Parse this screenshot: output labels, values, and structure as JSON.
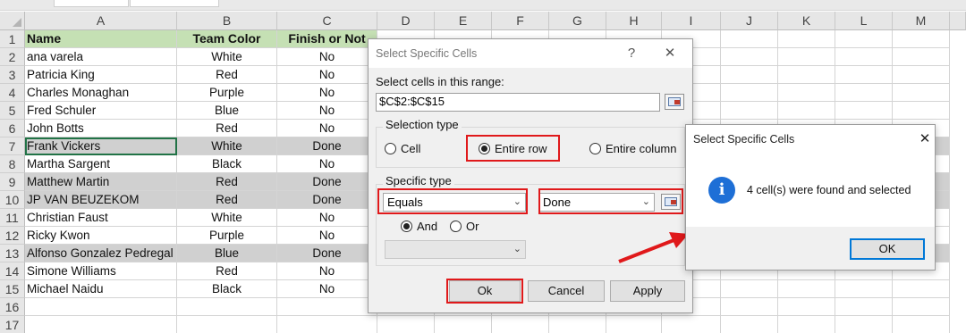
{
  "spreadsheet": {
    "columns": [
      "A",
      "B",
      "C",
      "D",
      "E",
      "F",
      "G",
      "H",
      "I",
      "J",
      "K",
      "L",
      "M"
    ],
    "rows": [
      {
        "num": "1",
        "a": "Name",
        "b": "Team Color",
        "c": "Finish or Not",
        "header": true
      },
      {
        "num": "2",
        "a": "ana varela",
        "b": "White",
        "c": "No"
      },
      {
        "num": "3",
        "a": "Patricia King",
        "b": "Red",
        "c": "No"
      },
      {
        "num": "4",
        "a": "Charles Monaghan",
        "b": "Purple",
        "c": "No"
      },
      {
        "num": "5",
        "a": "Fred Schuler",
        "b": "Blue",
        "c": "No"
      },
      {
        "num": "6",
        "a": "John Botts",
        "b": "Red",
        "c": "No"
      },
      {
        "num": "7",
        "a": "Frank Vickers",
        "b": "White",
        "c": "Done",
        "selected": true
      },
      {
        "num": "8",
        "a": "Martha Sargent",
        "b": "Black",
        "c": "No"
      },
      {
        "num": "9",
        "a": "Matthew Martin",
        "b": "Red",
        "c": "Done",
        "selected": true
      },
      {
        "num": "10",
        "a": "JP VAN BEUZEKOM",
        "b": "Red",
        "c": "Done",
        "selected": true
      },
      {
        "num": "11",
        "a": "Christian Faust",
        "b": "White",
        "c": "No"
      },
      {
        "num": "12",
        "a": "Ricky Kwon",
        "b": "Purple",
        "c": "No"
      },
      {
        "num": "13",
        "a": "Alfonso Gonzalez Pedregal",
        "b": "Blue",
        "c": "Done",
        "selected": true
      },
      {
        "num": "14",
        "a": "Simone Williams",
        "b": "Red",
        "c": "No"
      },
      {
        "num": "15",
        "a": "Michael Naidu",
        "b": "Black",
        "c": "No"
      },
      {
        "num": "16",
        "a": "",
        "b": "",
        "c": ""
      },
      {
        "num": "17",
        "a": "",
        "b": "",
        "c": ""
      }
    ]
  },
  "select_dialog": {
    "title": "Select Specific Cells",
    "help": "?",
    "close": "✕",
    "range_label": "Select cells in this range:",
    "range_value": "$C$2:$C$15",
    "selection_type_label": "Selection type",
    "opt_cell": "Cell",
    "opt_entire_row": "Entire row",
    "opt_entire_column": "Entire column",
    "specific_type_label": "Specific type",
    "condition1": "Equals",
    "value1": "Done",
    "logic_and": "And",
    "logic_or": "Or",
    "ok": "Ok",
    "cancel": "Cancel",
    "apply": "Apply"
  },
  "result_dialog": {
    "title": "Select Specific Cells",
    "close": "✕",
    "message": "4 cell(s) were found and selected",
    "ok": "OK",
    "icon": "info-icon"
  },
  "colors": {
    "header_fill": "#c5e0b4",
    "selected_fill": "#d0d0d0",
    "highlight": "#e0191b",
    "info_blue": "#1e6fd6"
  }
}
